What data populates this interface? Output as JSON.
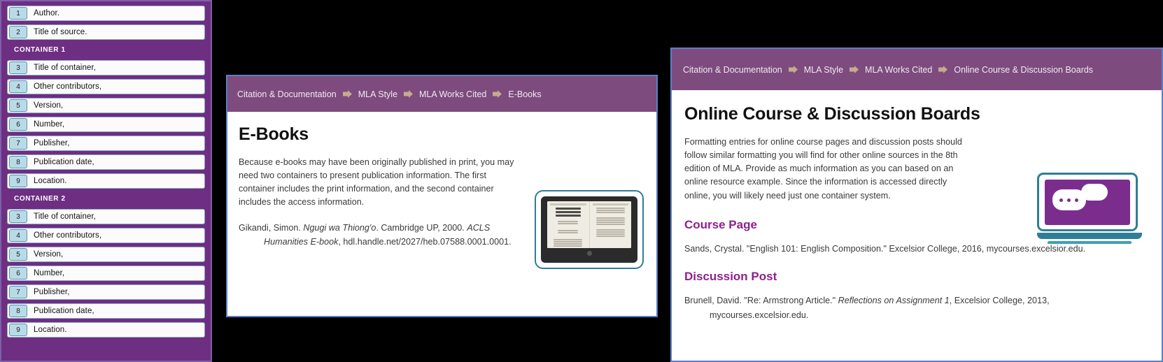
{
  "left_panel": {
    "name": "MLA container system diagram",
    "accent_color": "#6e2e82",
    "number_chip_color": "#b9dbe8",
    "core_elements": [
      {
        "num": "1",
        "label": "Author."
      },
      {
        "num": "2",
        "label": "Title of source."
      }
    ],
    "container_1": {
      "heading": "CONTAINER 1",
      "elements": [
        {
          "num": "3",
          "label": "Title of container,"
        },
        {
          "num": "4",
          "label": "Other contributors,"
        },
        {
          "num": "5",
          "label": "Version,"
        },
        {
          "num": "6",
          "label": "Number,"
        },
        {
          "num": "7",
          "label": "Publisher,"
        },
        {
          "num": "8",
          "label": "Publication date,"
        },
        {
          "num": "9",
          "label": "Location."
        }
      ]
    },
    "container_2": {
      "heading": "CONTAINER 2",
      "elements": [
        {
          "num": "3",
          "label": "Title of container,"
        },
        {
          "num": "4",
          "label": "Other contributors,"
        },
        {
          "num": "5",
          "label": "Version,"
        },
        {
          "num": "6",
          "label": "Number,"
        },
        {
          "num": "7",
          "label": "Publisher,"
        },
        {
          "num": "8",
          "label": "Publication date,"
        },
        {
          "num": "9",
          "label": "Location."
        }
      ]
    }
  },
  "middle_panel": {
    "breadcrumb": [
      "Citation & Documentation",
      "MLA Style",
      "MLA Works Cited",
      "E-Books"
    ],
    "breadcrumb_bg": "#7d4b7e",
    "title": "E-Books",
    "paragraph": "Because e-books may have been originally published in print, you may need two containers to present publication information. The first container includes the print information, and the second container includes the access information.",
    "citation": {
      "line1_a": "Gikandi, Simon. ",
      "line1_italic": "Ngugi wa Thiong'o",
      "line1_b": ". Cambridge UP, 2000. ",
      "line1_italic2": "ACLS",
      "line2_italic": "Humanities E-book",
      "line2_b": ", hdl.handle.net/2027/heb.07588.0001.0001."
    },
    "illustration": "e-reader-tablet-icon"
  },
  "right_panel": {
    "breadcrumb": [
      "Citation & Documentation",
      "MLA Style",
      "MLA Works Cited",
      "Online Course & Discussion Boards"
    ],
    "breadcrumb_bg": "#7d4b7e",
    "title": "Online Course & Discussion Boards",
    "paragraph": "Formatting entries for online course pages and discussion posts should follow similar formatting you will find for other online sources in the 8th edition of MLA. Provide as much information as you can based on an online resource example. Since the information is accessed directly online, you will likely need just one container system.",
    "section_heading_color": "#8e1f8e",
    "course_page": {
      "heading": "Course Page",
      "citation": "Sands, Crystal. \"English 101: English Composition.\" Excelsior College, 2016, mycourses.excelsior.edu."
    },
    "discussion_post": {
      "heading": "Discussion Post",
      "citation_a": "Brunell, David. \"Re: Armstrong Article.\" ",
      "citation_italic": "Reflections on Assignment 1",
      "citation_b": ", Excelsior College, 2013,",
      "citation_line2": "mycourses.excelsior.edu."
    },
    "illustration": "laptop-chat-bubbles-icon"
  }
}
